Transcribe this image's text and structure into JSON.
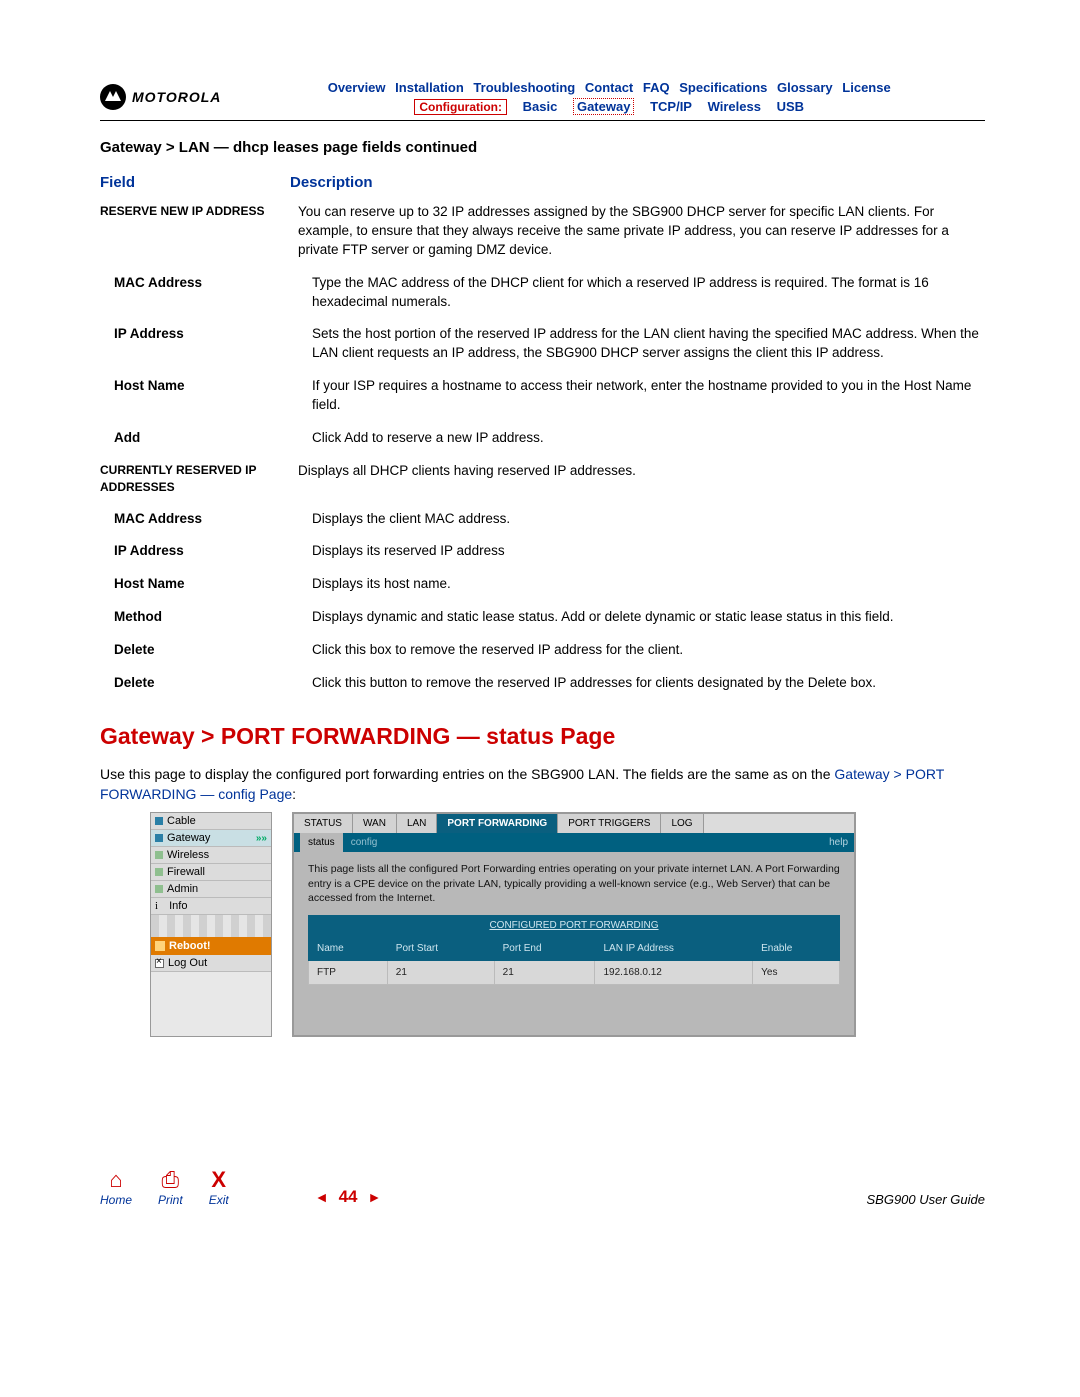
{
  "brand": "MOTOROLA",
  "topnav": [
    "Overview",
    "Installation",
    "Troubleshooting",
    "Contact",
    "FAQ",
    "Specifications",
    "Glossary",
    "License"
  ],
  "subnav": {
    "active": "Configuration:",
    "items": [
      "Basic",
      "Gateway",
      "TCP/IP",
      "Wireless",
      "USB"
    ],
    "dotted_index": 1
  },
  "section_title": "Gateway > LAN — dhcp leases page fields continued",
  "headers": {
    "field": "Field",
    "desc": "Description"
  },
  "rows": [
    {
      "field": "RESERVE NEW IP ADDRESS",
      "indent": false,
      "upper": true,
      "desc": "You can reserve up to 32 IP addresses assigned by the SBG900 DHCP server for specific LAN clients. For example, to ensure that they always receive the same private IP address, you can reserve IP addresses for a private FTP server or gaming DMZ device."
    },
    {
      "field": "MAC Address",
      "indent": true,
      "desc": "Type the MAC address of the DHCP client for which a reserved IP address is required. The format is 16 hexadecimal numerals."
    },
    {
      "field": "IP Address",
      "indent": true,
      "desc": "Sets the host portion of the reserved IP address for the LAN client having the specified MAC address. When the LAN client requests an IP address, the SBG900 DHCP server assigns the client this IP address."
    },
    {
      "field": "Host Name",
      "indent": true,
      "desc": "If your ISP requires a hostname to access their network, enter the hostname provided to you in the Host Name field."
    },
    {
      "field": "Add",
      "indent": true,
      "desc": "Click Add to reserve a new IP address."
    },
    {
      "field": "CURRENTLY RESERVED IP ADDRESSES",
      "indent": false,
      "upper": true,
      "desc": "Displays all DHCP clients having reserved IP addresses."
    },
    {
      "field": "MAC Address",
      "indent": true,
      "desc": "Displays the client MAC address."
    },
    {
      "field": "IP Address",
      "indent": true,
      "desc": "Displays its reserved IP address"
    },
    {
      "field": "Host Name",
      "indent": true,
      "desc": "Displays its host name."
    },
    {
      "field": "Method",
      "indent": true,
      "desc": "Displays dynamic and static lease status. Add or delete dynamic or static lease status in this field."
    },
    {
      "field": "Delete",
      "indent": true,
      "desc": "Click this box to remove the reserved IP address for the client."
    },
    {
      "field": "Delete",
      "indent": true,
      "desc": "Click this button to remove the reserved IP addresses for clients designated by the Delete box."
    }
  ],
  "big_heading": "Gateway > PORT FORWARDING — status Page",
  "intro_text": "Use this page to display the configured port forwarding entries on the SBG900 LAN. The fields are the same as on the ",
  "intro_link": "Gateway > PORT FORWARDING — config Page",
  "intro_tail": ":",
  "side_menu": {
    "items": [
      {
        "label": "Cable",
        "sq": "blue"
      },
      {
        "label": "Gateway",
        "sq": "blue",
        "sel": true,
        "arrow": true
      },
      {
        "label": "Wireless",
        "sq": "g"
      },
      {
        "label": "Firewall",
        "sq": "g"
      },
      {
        "label": "Admin",
        "sq": "g"
      },
      {
        "label": "Info",
        "sq": "i"
      }
    ],
    "reboot": "Reboot!",
    "logout": "Log Out"
  },
  "app": {
    "tabs": [
      "STATUS",
      "WAN",
      "LAN",
      "PORT FORWARDING",
      "PORT TRIGGERS",
      "LOG"
    ],
    "active_tab": 3,
    "subtabs": {
      "active": "status",
      "other": "config",
      "help": "help"
    },
    "desc": "This page lists all the configured Port Forwarding entries operating on your private internet LAN. A Port Forwarding entry is a CPE device on the private LAN, typically providing a well-known service (e.g., Web Server) that can be accessed from the Internet.",
    "table_title": "CONFIGURED PORT FORWARDING",
    "columns": [
      "Name",
      "Port Start",
      "Port End",
      "LAN IP Address",
      "Enable"
    ],
    "row": [
      "FTP",
      "21",
      "21",
      "192.168.0.12",
      "Yes"
    ]
  },
  "footer": {
    "home": "Home",
    "print": "Print",
    "exit": "Exit",
    "page": "44",
    "guide": "SBG900 User Guide"
  }
}
